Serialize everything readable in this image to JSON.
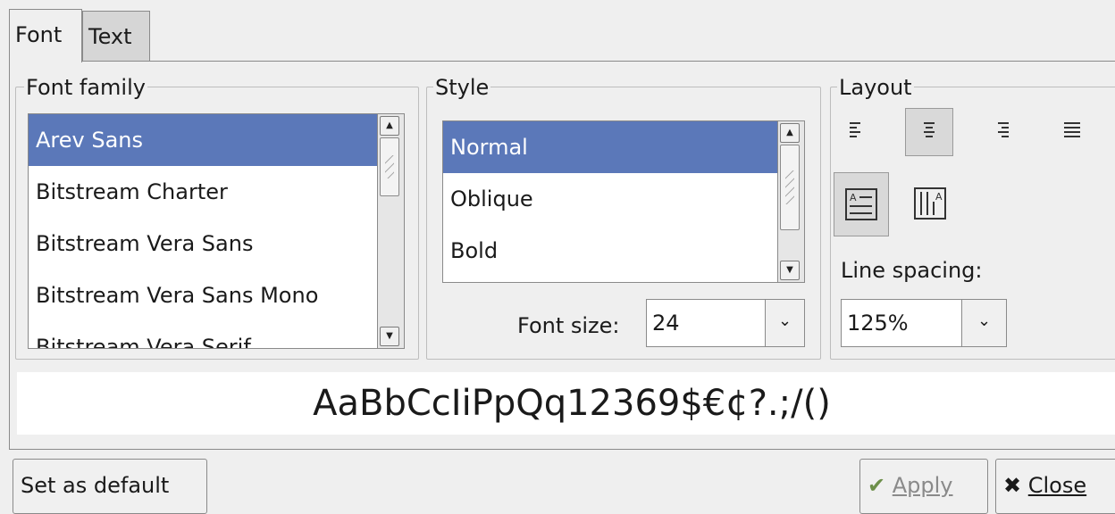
{
  "tabs": [
    {
      "label": "Font",
      "active": true
    },
    {
      "label": "Text",
      "active": false
    }
  ],
  "font_family": {
    "legend": "Font family",
    "items": [
      "Arev Sans",
      "Bitstream Charter",
      "Bitstream Vera Sans",
      "Bitstream Vera Sans Mono",
      "Bitstream Vera Serif"
    ],
    "selected": "Arev Sans"
  },
  "style": {
    "legend": "Style",
    "items": [
      "Normal",
      "Oblique",
      "Bold"
    ],
    "selected": "Normal",
    "font_size_label": "Font size:",
    "font_size_value": "24"
  },
  "layout": {
    "legend": "Layout",
    "align_options": [
      "align-left",
      "align-center",
      "align-right",
      "justify"
    ],
    "selected_align": "align-center",
    "direction_options": [
      "horizontal-text",
      "vertical-text"
    ],
    "selected_direction": "horizontal-text",
    "line_spacing_label": "Line spacing:",
    "line_spacing_value": "125%"
  },
  "preview_text": "AaBbCcIiPpQq12369$€¢?.;/()",
  "buttons": {
    "set_default": "Set as default",
    "apply": "Apply",
    "close": "Close"
  },
  "colors": {
    "selection": "#5b78b9",
    "background": "#efefef"
  }
}
